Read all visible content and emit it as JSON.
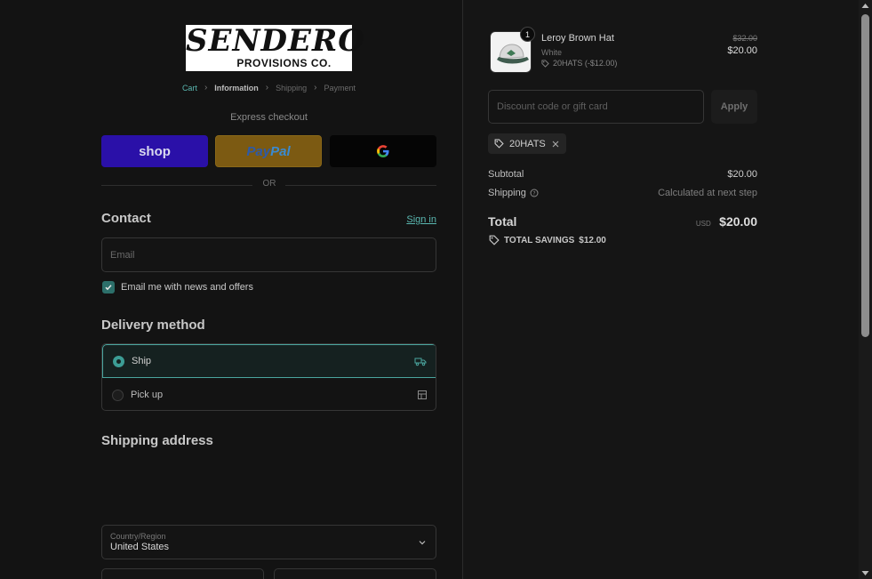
{
  "logo": {
    "line1": "SENDERO",
    "line2": "PROVISIONS CO."
  },
  "breadcrumb": {
    "cart": "Cart",
    "information": "Information",
    "shipping": "Shipping",
    "payment": "Payment",
    "separator": "›"
  },
  "express": {
    "title": "Express checkout",
    "shop_label": "shop",
    "paypal_label_1": "Pay",
    "paypal_label_2": "Pal",
    "google_label": "G",
    "or": "OR"
  },
  "contact": {
    "heading": "Contact",
    "sign_in": "Sign in",
    "email_placeholder": "Email",
    "newsletter_label": "Email me with news and offers",
    "newsletter_checked": true
  },
  "delivery": {
    "heading": "Delivery method",
    "options": [
      {
        "label": "Ship",
        "selected": true,
        "icon": "truck-icon"
      },
      {
        "label": "Pick up",
        "selected": false,
        "icon": "store-icon"
      }
    ]
  },
  "shipping_address": {
    "heading": "Shipping address",
    "country_label": "Country/Region",
    "country_value": "United States"
  },
  "order": {
    "item": {
      "name": "Leroy Brown Hat",
      "variant": "White",
      "discount": "20HATS (-$12.00)",
      "quantity": "1",
      "original_price": "$32.00",
      "price": "$20.00"
    },
    "discount_placeholder": "Discount code or gift card",
    "apply_label": "Apply",
    "applied_code": "20HATS",
    "subtotal_label": "Subtotal",
    "subtotal_value": "$20.00",
    "shipping_label": "Shipping",
    "shipping_value": "Calculated at next step",
    "total_label": "Total",
    "total_currency": "USD",
    "total_value": "$20.00",
    "savings_label": "TOTAL SAVINGS",
    "savings_value": "$12.00"
  },
  "colors": {
    "accent": "#5ab7b0",
    "shop_pay": "#2a10a8",
    "paypal": "#7c5a12",
    "background": "#131313"
  }
}
